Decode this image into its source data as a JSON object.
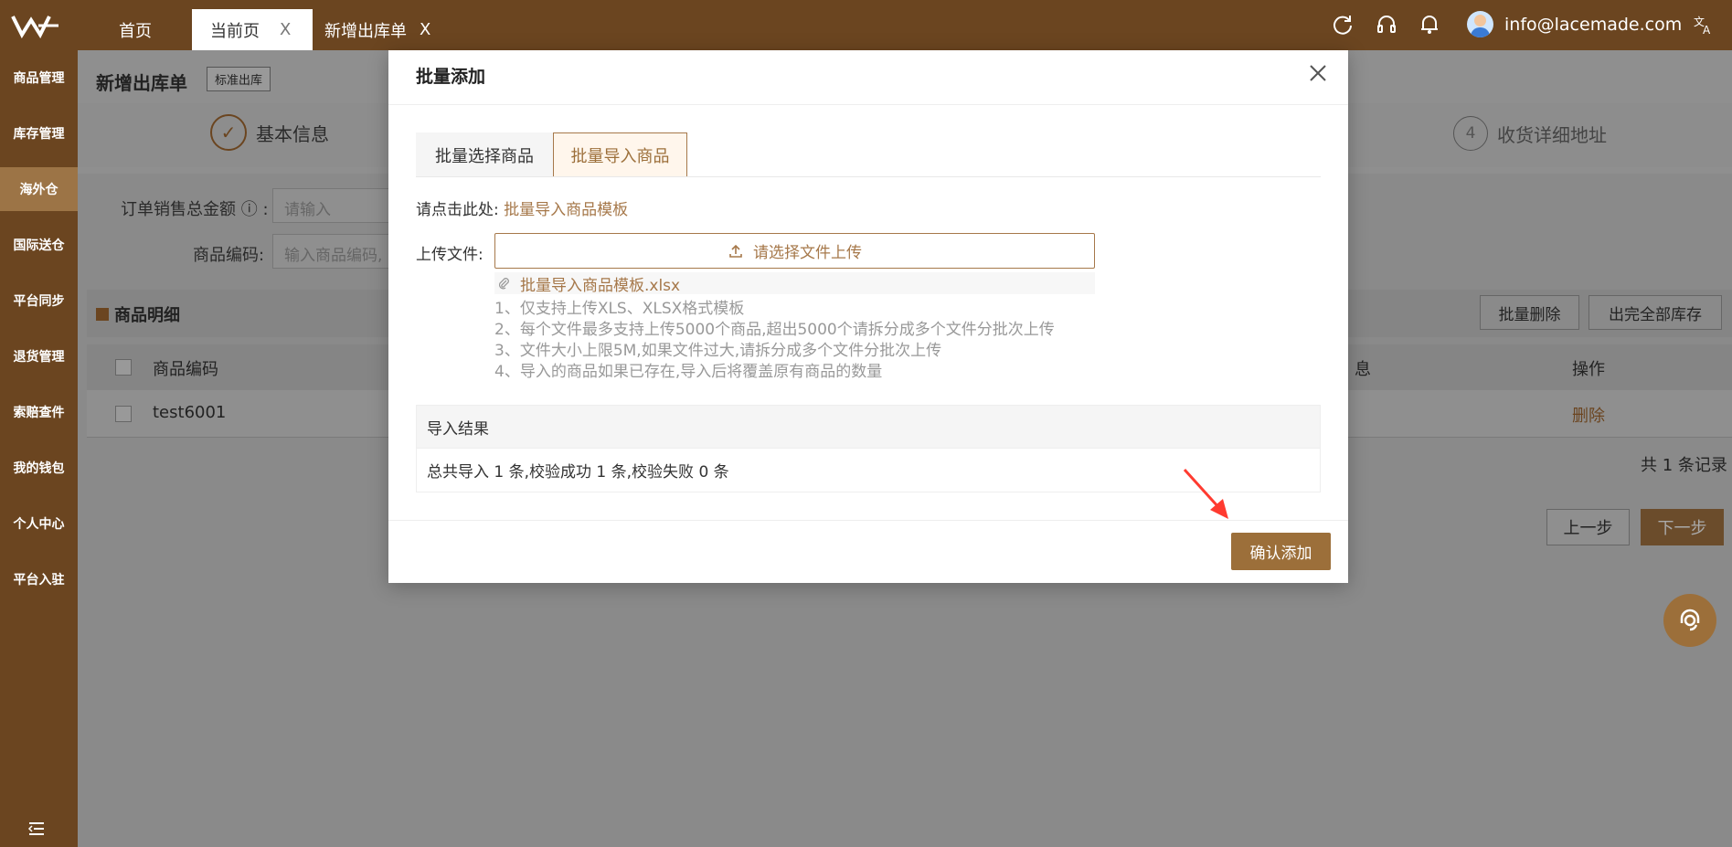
{
  "topbar": {
    "tabs": [
      {
        "label": "首页"
      },
      {
        "label": "当前页",
        "close": "X"
      },
      {
        "label": "新增出库单",
        "close": "X"
      }
    ],
    "user_email": "info@lacemade.com"
  },
  "sidebar": {
    "items": [
      {
        "label": "商品管理"
      },
      {
        "label": "库存管理"
      },
      {
        "label": "海外仓"
      },
      {
        "label": "国际送仓"
      },
      {
        "label": "平台同步"
      },
      {
        "label": "退货管理"
      },
      {
        "label": "索赔查件"
      },
      {
        "label": "我的钱包"
      },
      {
        "label": "个人中心"
      },
      {
        "label": "平台入驻"
      }
    ]
  },
  "page": {
    "title": "新增出库单",
    "tag": "标准出库",
    "step1_label": "基本信息",
    "step4_num": "4",
    "step4_label": "收货详细地址",
    "amount_label": "订单销售总金额",
    "amount_info_icon": "ⓘ",
    "amount_colon": ":",
    "amount_placeholder": "请输入",
    "code_label": "商品编码:",
    "code_placeholder": "输入商品编码,",
    "section_title": "商品明细",
    "batch_delete": "批量删除",
    "out_all": "出完全部库存",
    "col_code": "商品编码",
    "col_info": "息",
    "col_op": "操作",
    "row_code": "test6001",
    "row_delete": "删除",
    "records": "共 1 条记录",
    "prev": "上一步",
    "next": "下一步"
  },
  "modal": {
    "title": "批量添加",
    "tab_select": "批量选择商品",
    "tab_import": "批量导入商品",
    "click_here": "请点击此处:",
    "template_link": "批量导入商品模板",
    "upload_label": "上传文件:",
    "upload_button": "请选择文件上传",
    "file_name": "批量导入商品模板.xlsx",
    "notes": [
      "1、仅支持上传XLS、XLSX格式模板",
      "2、每个文件最多支持上传5000个商品,超出5000个请拆分成多个文件分批次上传",
      "3、文件大小上限5M,如果文件过大,请拆分成多个文件分批次上传",
      "4、导入的商品如果已存在,导入后将覆盖原有商品的数量"
    ],
    "result_title": "导入结果",
    "result_text": "总共导入 1 条,校验成功 1 条,校验失败 0 条",
    "confirm": "确认添加"
  },
  "colors": {
    "brand": "#6b4520",
    "accent": "#9c6f3a",
    "annotation_arrow": "#ff3b30"
  },
  "icons": [
    "logo-icon",
    "refresh-icon",
    "headset-icon",
    "bell-icon",
    "translate-icon",
    "close-icon",
    "upload-icon",
    "paperclip-icon",
    "menu-collapse-icon",
    "support-icon"
  ]
}
